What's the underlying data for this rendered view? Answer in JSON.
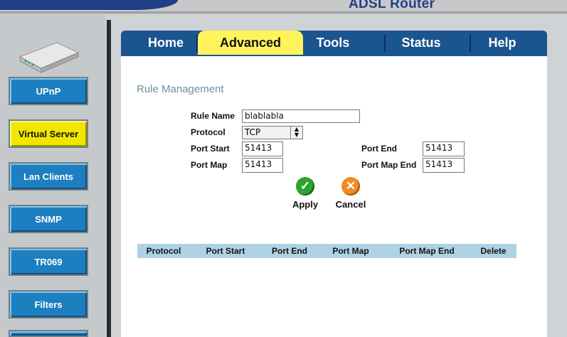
{
  "brand": {
    "product": "ADSL Router"
  },
  "sidebar": {
    "items": [
      {
        "label": "UPnP"
      },
      {
        "label": "Virtual Server",
        "active": true
      },
      {
        "label": "Lan Clients"
      },
      {
        "label": "SNMP"
      },
      {
        "label": "TR069"
      },
      {
        "label": "Filters"
      }
    ]
  },
  "tabs": {
    "home": "Home",
    "advanced": "Advanced",
    "tools": "Tools",
    "status": "Status",
    "help": "Help"
  },
  "form": {
    "title": "Rule Management",
    "rule_name_label": "Rule Name",
    "rule_name_value": "blablabla",
    "protocol_label": "Protocol",
    "protocol_value": "TCP",
    "port_start_label": "Port Start",
    "port_start_value": "51413",
    "port_end_label": "Port End",
    "port_end_value": "51413",
    "port_map_label": "Port Map",
    "port_map_value": "51413",
    "port_map_end_label": "Port Map End",
    "port_map_end_value": "51413"
  },
  "actions": {
    "apply": "Apply",
    "cancel": "Cancel"
  },
  "table": {
    "headers": [
      "Protocol",
      "Port Start",
      "Port End",
      "Port Map",
      "Port Map End",
      "Delete"
    ]
  },
  "colors": {
    "accent_tab": "#fff45c",
    "nav_blue": "#1d7fbf",
    "active_nav": "#f2e600",
    "table_header": "#aed2e3"
  }
}
